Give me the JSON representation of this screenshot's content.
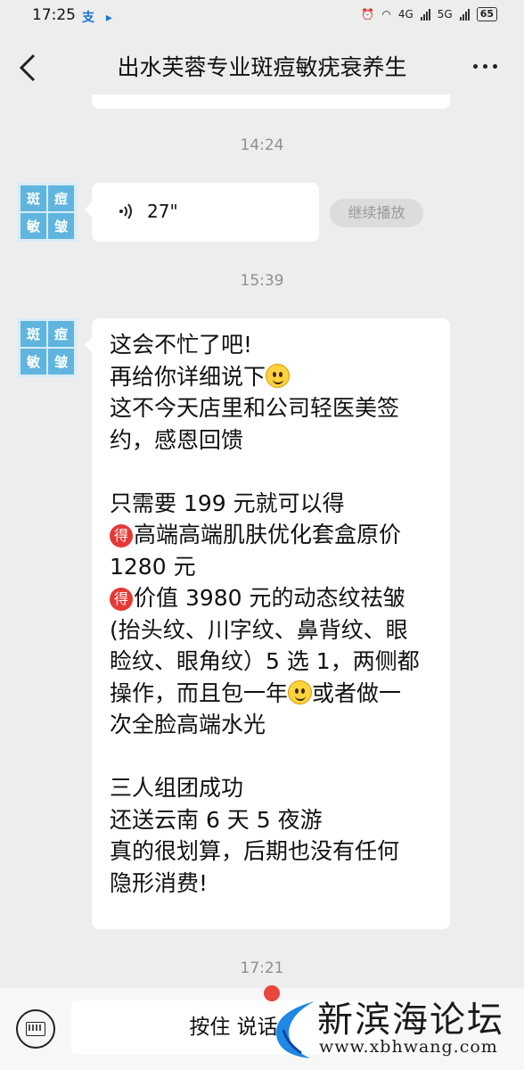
{
  "status_bar": {
    "time": "17:25",
    "app_icons": "支 ▸",
    "network_1": "4G",
    "network_2": "5G",
    "battery": "65"
  },
  "header": {
    "title": "出水芙蓉专业斑痘敏疣衰养生"
  },
  "timestamps": [
    "14:24",
    "15:39",
    "17:21"
  ],
  "avatar": {
    "chars": [
      "斑",
      "痘",
      "敏",
      "皱"
    ]
  },
  "voice_message": {
    "duration": "27\"",
    "continue_label": "继续播放"
  },
  "text_message": {
    "lines": [
      "这会不忙了吧!",
      "再给你详细说下",
      "这不今天店里和公司轻医美签",
      "约，感恩回馈",
      "",
      "只需要 199 元就可以得",
      "高端高端肌肤优化套盒原价",
      "1280 元",
      "价值 3980 元的动态纹祛皱",
      "(抬头纹、川字纹、鼻背纹、眼",
      "睑纹、眼角纹）5 选 1，两侧都",
      "操作，而且包一年",
      "次全脸高端水光",
      "",
      "三人组团成功",
      "还送云南 6 天 5 夜游",
      "真的很划算，后期也没有任何",
      "隐形消费!"
    ],
    "line11_tail": "或者做一",
    "badge_char": "得",
    "emoji_name": "smile-emoji"
  },
  "bottom_bar": {
    "hold_to_talk": "按住 说话"
  },
  "watermark": {
    "title": "新滨海论坛",
    "url": "www.xbhwang.com"
  },
  "colors": {
    "background": "#ededed",
    "bubble": "#ffffff",
    "badge": "#e53935",
    "timestamp": "#8f8f8f"
  }
}
